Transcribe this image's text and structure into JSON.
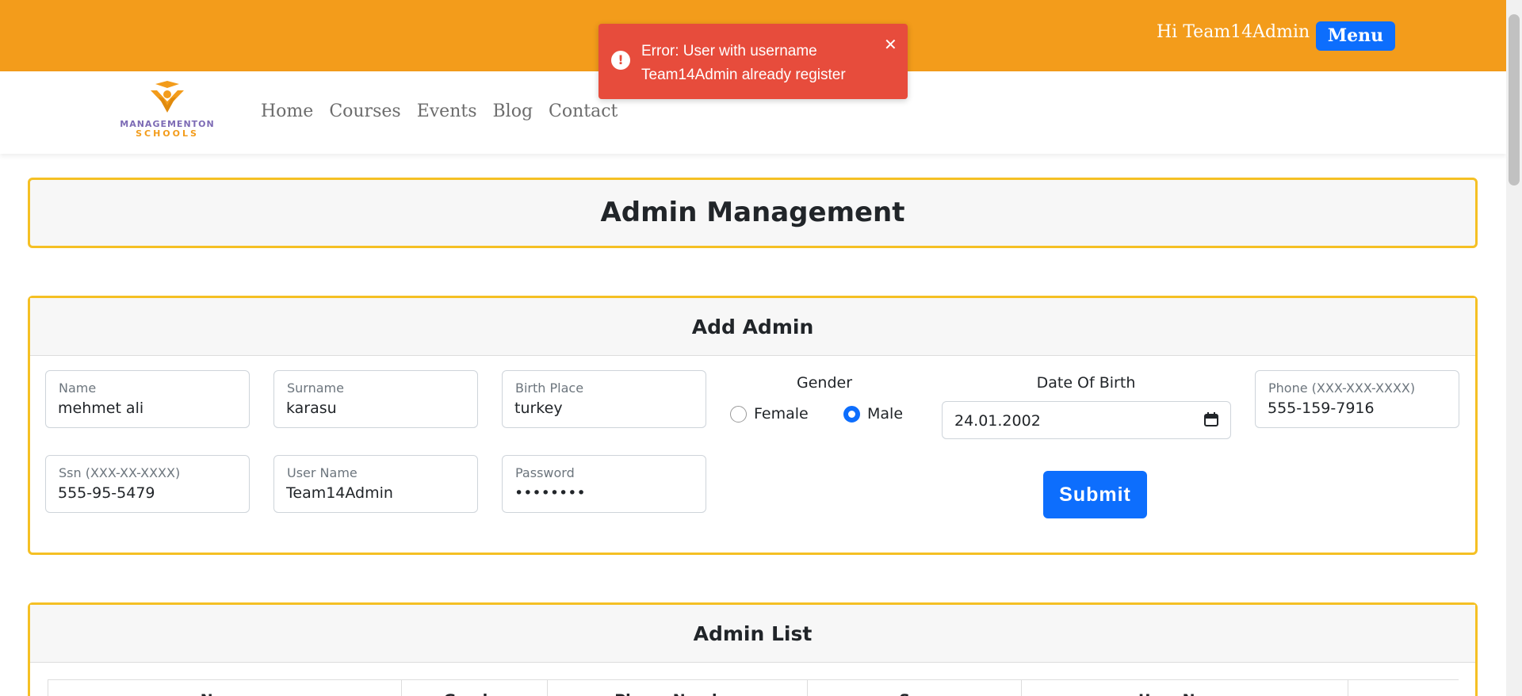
{
  "header": {
    "greeting": "Hi Team14Admin",
    "menu_label": "Menu"
  },
  "logo": {
    "name": "MANAGEMENTON",
    "sub": "SCHOOLS"
  },
  "nav": {
    "items": [
      "Home",
      "Courses",
      "Events",
      "Blog",
      "Contact"
    ]
  },
  "toast": {
    "icon": "!",
    "message": "Error: User with username Team14Admin already register",
    "close": "✕"
  },
  "page": {
    "title": "Admin Management"
  },
  "form": {
    "heading": "Add Admin",
    "name": {
      "label": "Name",
      "value": "mehmet ali"
    },
    "surname": {
      "label": "Surname",
      "value": "karasu"
    },
    "birth_place": {
      "label": "Birth Place",
      "value": "turkey"
    },
    "gender": {
      "label": "Gender",
      "options": [
        "Female",
        "Male"
      ],
      "selected": "Male"
    },
    "dob": {
      "label": "Date Of Birth",
      "value": "24.01.2002"
    },
    "phone": {
      "label": "Phone (XXX-XXX-XXXX)",
      "value": "555-159-7916"
    },
    "ssn": {
      "label": "Ssn (XXX-XX-XXXX)",
      "value": "555-95-5479"
    },
    "username": {
      "label": "User Name",
      "value": "Team14Admin"
    },
    "password": {
      "label": "Password",
      "value": "••••••••"
    },
    "submit_label": "Submit"
  },
  "admin_list": {
    "heading": "Admin List",
    "columns": [
      "Name",
      "Gender",
      "Phone Number",
      "Ssn",
      "User Name",
      ""
    ]
  },
  "colors": {
    "topbar": "#f39c1b",
    "primary": "#0d6efd",
    "toast": "#e74c3c",
    "card_border": "#f5c024"
  }
}
